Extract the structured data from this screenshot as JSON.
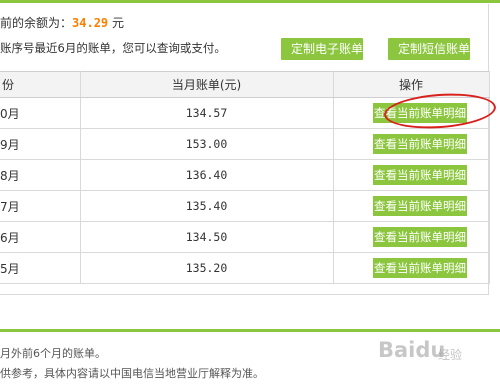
{
  "summary": {
    "balance_label": "前的余额为：",
    "balance_amount": "34.29",
    "balance_unit": "元",
    "intro_text": "账序号最近6月的账单，您可以查询或支付。"
  },
  "actions": {
    "ebill_button": "定制电子账单",
    "sms_button": "定制短信账单"
  },
  "table": {
    "headers": {
      "month": "份",
      "amount": "当月账单(元)",
      "action": "操作"
    },
    "rows": [
      {
        "month": "0月",
        "amount": "134.57",
        "action": "查看当前账单明细"
      },
      {
        "month": "9月",
        "amount": "153.00",
        "action": "查看当前账单明细"
      },
      {
        "month": "8月",
        "amount": "136.40",
        "action": "查看当前账单明细"
      },
      {
        "month": "7月",
        "amount": "135.40",
        "action": "查看当前账单明细"
      },
      {
        "month": "6月",
        "amount": "134.50",
        "action": "查看当前账单明细"
      },
      {
        "month": "5月",
        "amount": "135.20",
        "action": "查看当前账单明细"
      }
    ]
  },
  "notes": {
    "line1": "月外前6个月的账单。",
    "line2": "供参考，具体内容请以中国电信当地营业厅解释为准。"
  },
  "watermark": {
    "text": "Baidu",
    "sub": "经验"
  },
  "colors": {
    "accent_green": "#8cc63f",
    "amount_orange": "#ff7e00",
    "annotation_red": "#d8201c"
  }
}
